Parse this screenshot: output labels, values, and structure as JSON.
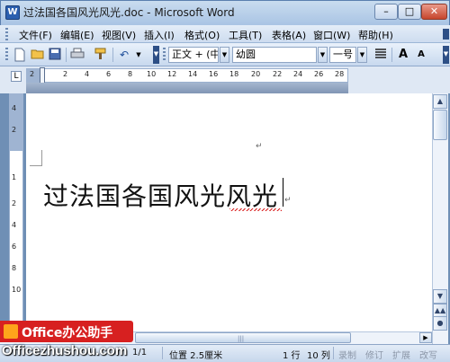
{
  "window": {
    "title": "过法国各国风光风光.doc - Microsoft Word",
    "app_icon": "W",
    "min_symbol": "–",
    "max_symbol": "□",
    "close_symbol": "✕"
  },
  "menu": {
    "items": [
      "文件(F)",
      "编辑(E)",
      "视图(V)",
      "插入(I)",
      "格式(O)",
      "工具(T)",
      "表格(A)",
      "窗口(W)",
      "帮助(H)"
    ]
  },
  "toolbar": {
    "style_value": "正文 + (中)",
    "font_value": "幼圆",
    "size_value": "一号",
    "grow_label": "A",
    "shrink_label": "A",
    "icons": [
      "new-icon",
      "open-icon",
      "save-icon",
      "print-icon",
      "format-painter-icon",
      "undo-icon"
    ],
    "undo_symbol": "↶"
  },
  "ruler": {
    "tab_symbol": "L",
    "h_numbers": [
      "2",
      "2",
      "4",
      "6",
      "8",
      "10",
      "12",
      "14",
      "16",
      "18",
      "20",
      "22",
      "24",
      "26",
      "28"
    ],
    "v_numbers": [
      "4",
      "2",
      "1",
      "2",
      "4",
      "6",
      "8",
      "10"
    ]
  },
  "document": {
    "body_text": "过法国各国风光风光",
    "paragraph_mark": "↵"
  },
  "scrollbar": {
    "up_symbol": "▲",
    "down_symbol": "▼",
    "right_symbol": "▶",
    "grip_symbol": "|||"
  },
  "watermark": {
    "logo_text": "Office办公助手",
    "site_text": "Officezhushou.com"
  },
  "status": {
    "page": "1/1",
    "position": "位置 2.5厘米",
    "line": "1 行",
    "column": "10 列",
    "rec": "录制",
    "trk": "修订",
    "ext": "扩展",
    "ovr": "改写"
  },
  "colors": {
    "title_bar": "#b9d0ea",
    "document_bg": "#ffffff",
    "spell_underline": "#d92020",
    "logo_red": "#d72020",
    "logo_orange": "#ffa41b"
  }
}
